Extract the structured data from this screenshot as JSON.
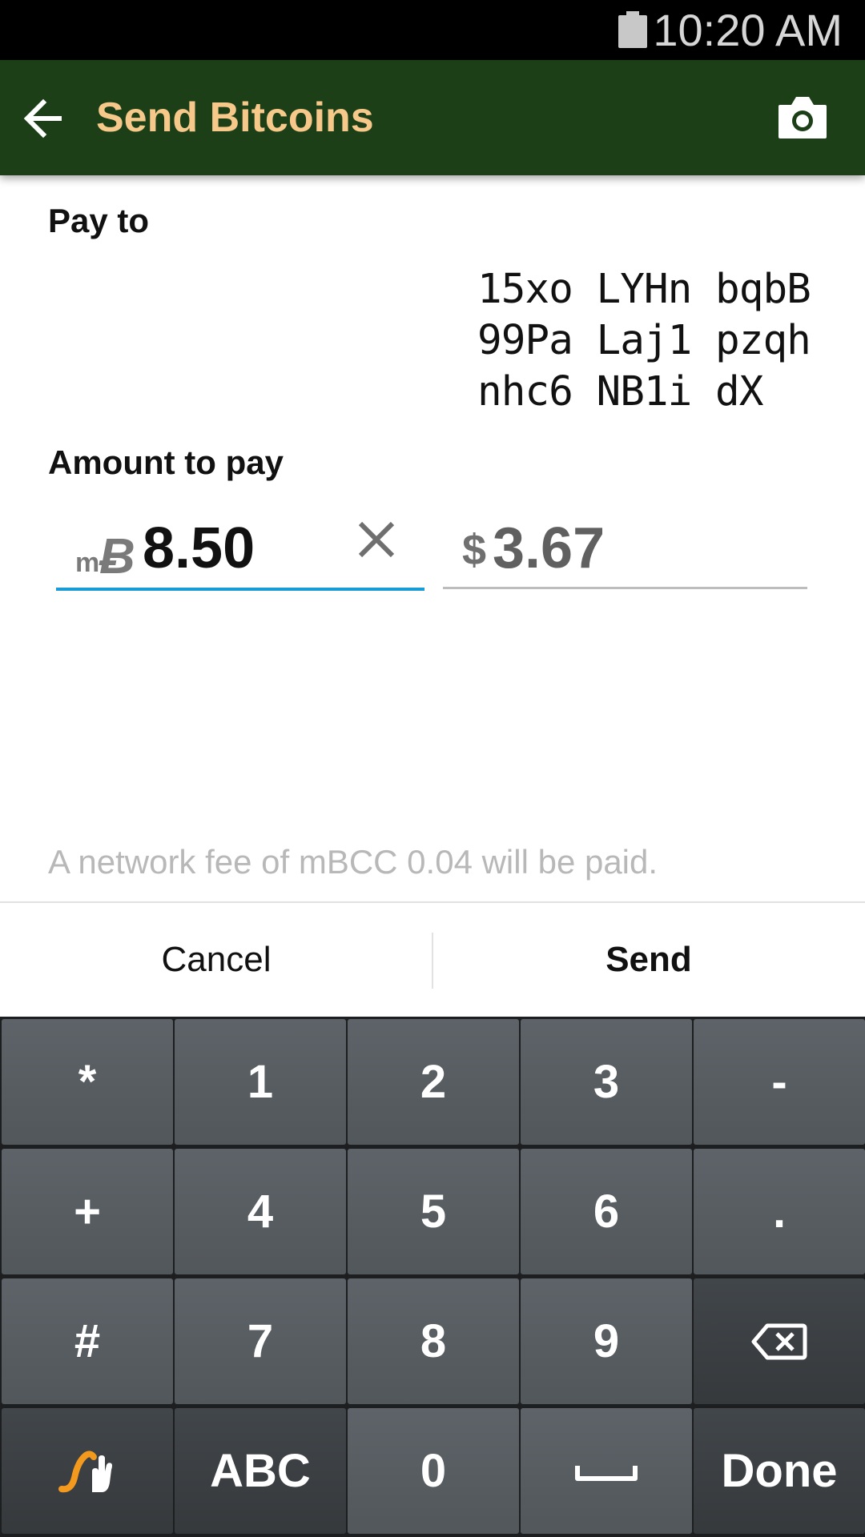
{
  "status_bar": {
    "time": "10:20 AM",
    "battery_icon": "battery-icon"
  },
  "app_bar": {
    "title": "Send Bitcoins",
    "back_icon": "arrow-back-icon",
    "camera_icon": "camera-icon",
    "background": "#1d3f18",
    "title_color": "#f6c98a"
  },
  "form": {
    "pay_to_label": "Pay to",
    "address_lines": [
      "15xo LYHn bqbB",
      "99Pa Laj1 pzqh",
      "nhc6 NB1i dX"
    ],
    "amount_label": "Amount to pay",
    "btc_unit_prefix": "m",
    "btc_unit_symbol": "Ƀ",
    "btc_amount": "8.50",
    "clear_icon": "close-icon",
    "fiat_symbol": "$",
    "fiat_amount": "3.67",
    "fee_note": "A network fee of mBCC 0.04 will be paid."
  },
  "actions": {
    "cancel_label": "Cancel",
    "send_label": "Send"
  },
  "keyboard": {
    "rows": [
      [
        "*",
        "1",
        "2",
        "3",
        "-"
      ],
      [
        "+",
        "4",
        "5",
        "6",
        "."
      ],
      [
        "#",
        "7",
        "8",
        "9",
        ""
      ],
      [
        "",
        "ABC",
        "0",
        "",
        "Done"
      ]
    ],
    "backspace_icon": "backspace-icon",
    "swype_icon": "swype-icon",
    "space_icon": "space-bar-icon",
    "accent": "#1a9ad6"
  }
}
